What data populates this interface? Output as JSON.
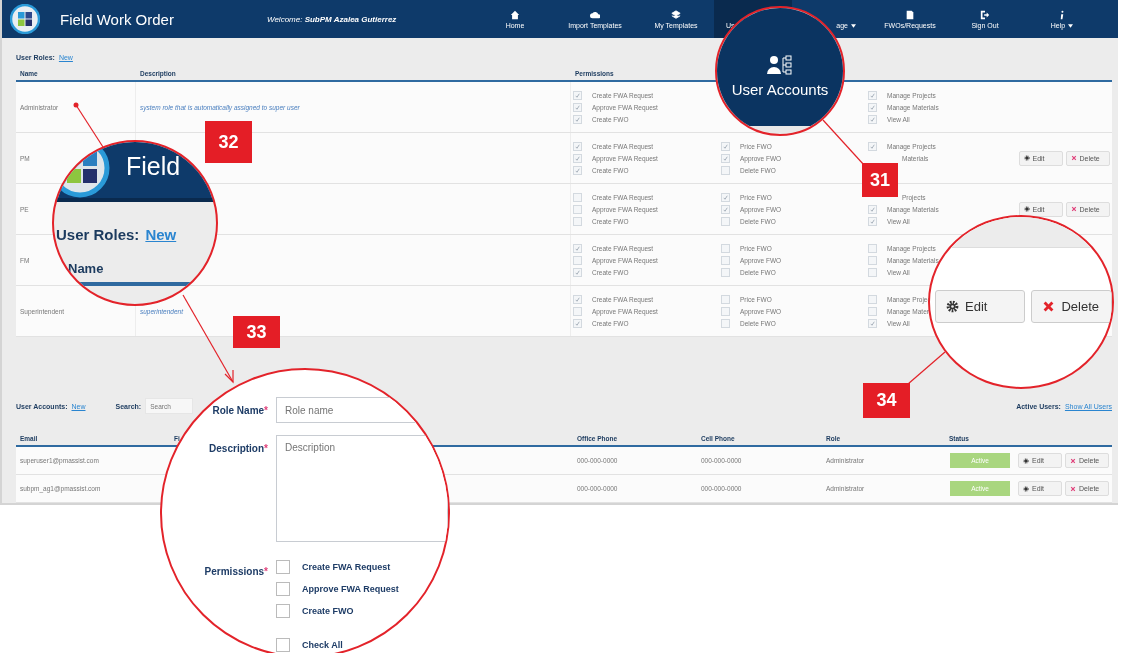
{
  "header": {
    "title": "Field Work Order",
    "welcome": "Welcome: **SubPM Azalea Gutierrez**"
  },
  "nav": [
    {
      "label": "Home",
      "kind": "home",
      "selected": false,
      "dropdown": false
    },
    {
      "label": "Import Templates",
      "kind": "import",
      "selected": false,
      "dropdown": false
    },
    {
      "label": "My Templates",
      "kind": "templates",
      "selected": false,
      "dropdown": false
    },
    {
      "label": "Us",
      "kind": "plain",
      "selected": true,
      "dropdown": false
    },
    {
      "label": "age",
      "kind": "plain",
      "selected": false,
      "dropdown": true
    },
    {
      "label": "FWOs/Requests",
      "kind": "list",
      "selected": false,
      "dropdown": false
    },
    {
      "label": "Sign Out",
      "kind": "signout",
      "selected": false,
      "dropdown": false
    },
    {
      "label": "Help",
      "kind": "info",
      "selected": false,
      "dropdown": true
    }
  ],
  "roles": {
    "label": "User Roles:",
    "link": "New",
    "columns": [
      "Name",
      "Description",
      "Permissions"
    ],
    "rows": [
      {
        "name": "Administrator",
        "description": "system role that is automatically assigned to super user",
        "perm_col_1": [
          {
            "label": "Create FWA Request",
            "checked": true
          },
          {
            "label": "Approve FWA Request",
            "checked": true
          },
          {
            "label": "Create FWO",
            "checked": true
          }
        ],
        "perm_col_3": [
          {
            "label": "Manage Projects",
            "checked": true
          },
          {
            "label": "Manage Materials",
            "checked": true
          },
          {
            "label": "View All",
            "checked": true
          }
        ],
        "actions": []
      },
      {
        "name": "PM",
        "perm_col_1": [
          {
            "label": "Create FWA Request",
            "checked": true
          },
          {
            "label": "Approve FWA Request",
            "checked": true
          },
          {
            "label": "Create FWO",
            "checked": true
          }
        ],
        "perm_col_2": [
          {
            "label": "Price FWO",
            "checked": true
          },
          {
            "label": "Approve FWO",
            "checked": true
          },
          {
            "label": "Delete FWO",
            "checked": false
          }
        ],
        "perm_col_3": [
          {
            "label": "Manage Projects",
            "checked": true
          },
          {
            "label": "Materials"
          }
        ],
        "actions": [
          "Edit",
          "Delete"
        ]
      },
      {
        "name": "PE",
        "perm_col_1": [
          {
            "label": "Create FWA Request",
            "checked": false
          },
          {
            "label": "Approve FWA Request",
            "checked": false
          },
          {
            "label": "Create FWO",
            "checked": false
          }
        ],
        "perm_col_2": [
          {
            "label": "Price FWO",
            "checked": true
          },
          {
            "label": "Approve FWO",
            "checked": true
          },
          {
            "label": "Delete FWO",
            "checked": false
          }
        ],
        "perm_col_3": [
          {
            "label": "Projects"
          },
          {
            "label": "Manage Materials",
            "checked": true
          },
          {
            "label": "View All",
            "checked": true
          }
        ],
        "actions": [
          "Edit",
          "Delete"
        ]
      },
      {
        "name": "FM",
        "perm_col_1": [
          {
            "label": "Create FWA Request",
            "checked": true
          },
          {
            "label": "Approve FWA Request",
            "checked": false
          },
          {
            "label": "Create FWO",
            "checked": true
          }
        ],
        "perm_col_2": [
          {
            "label": "Price FWO",
            "checked": false
          },
          {
            "label": "Approve FWO",
            "checked": false
          },
          {
            "label": "Delete FWO",
            "checked": false
          }
        ],
        "perm_col_3": [
          {
            "label": "Manage Projects",
            "checked": false
          },
          {
            "label": "Manage Materials",
            "checked": false
          },
          {
            "label": "View All",
            "checked": false
          }
        ],
        "actions": []
      },
      {
        "name": "Superintendent",
        "description": "superintendent",
        "perm_col_1": [
          {
            "label": "Create FWA Request",
            "checked": true
          },
          {
            "label": "Approve FWA Request",
            "checked": false
          },
          {
            "label": "Create FWO",
            "checked": true
          }
        ],
        "perm_col_2": [
          {
            "label": "Price FWO",
            "checked": false
          },
          {
            "label": "Approve FWO",
            "checked": false
          },
          {
            "label": "Delete FWO",
            "checked": false
          }
        ],
        "perm_col_3": [
          {
            "label": "Manage Projec",
            "checked": false
          },
          {
            "label": "Manage Mater",
            "checked": false
          },
          {
            "label": "View All",
            "checked": true
          }
        ],
        "actions": []
      }
    ]
  },
  "accounts": {
    "label": "User Accounts:",
    "link": "New",
    "search_label": "Search:",
    "search": {
      "placeholder": "Search"
    },
    "active_label": "Active Users:",
    "show_all": "Show All Users",
    "columns": [
      "Email",
      "Fi",
      "Office Phone",
      "Cell Phone",
      "Role",
      "Status"
    ],
    "rows": [
      {
        "email": "superuser1@pmassist.com",
        "office_phone": "000-000-0000",
        "cell_phone": "000-000-0000",
        "role": "Administrator",
        "status": "Active",
        "actions": [
          "Edit",
          "Delete"
        ]
      },
      {
        "email": "subpm_ag1@pmassist.com",
        "office_phone": "000-000-0000",
        "cell_phone": "000-000-0000",
        "role": "Administrator",
        "status": "Active",
        "actions": [
          "Edit",
          "Delete"
        ]
      }
    ]
  },
  "callouts": {
    "numbers": [
      "31",
      "32",
      "33",
      "34"
    ],
    "zoom_31": {
      "label": "User Accounts"
    },
    "zoom_32": {
      "title": "Field",
      "label": "User Roles:",
      "link": "New",
      "column": "Name"
    },
    "zoom_33": {
      "fields": [
        {
          "label": "Role Name",
          "mark": "*",
          "placeholder": "Role name",
          "kind": "input"
        },
        {
          "label": "Description",
          "mark": "*",
          "placeholder": "Description",
          "kind": "textarea"
        }
      ],
      "permissions_label": "Permissions",
      "permissions_mark": "*",
      "permissions": [
        {
          "label": "Create FWA Request",
          "checked": false
        },
        {
          "label": "Approve FWA Request",
          "checked": false
        },
        {
          "label": "Create FWO",
          "checked": false
        }
      ],
      "check_all": {
        "label": "Check All",
        "checked": false
      }
    },
    "zoom_34": {
      "actions": [
        "Edit",
        "Delete"
      ]
    }
  }
}
